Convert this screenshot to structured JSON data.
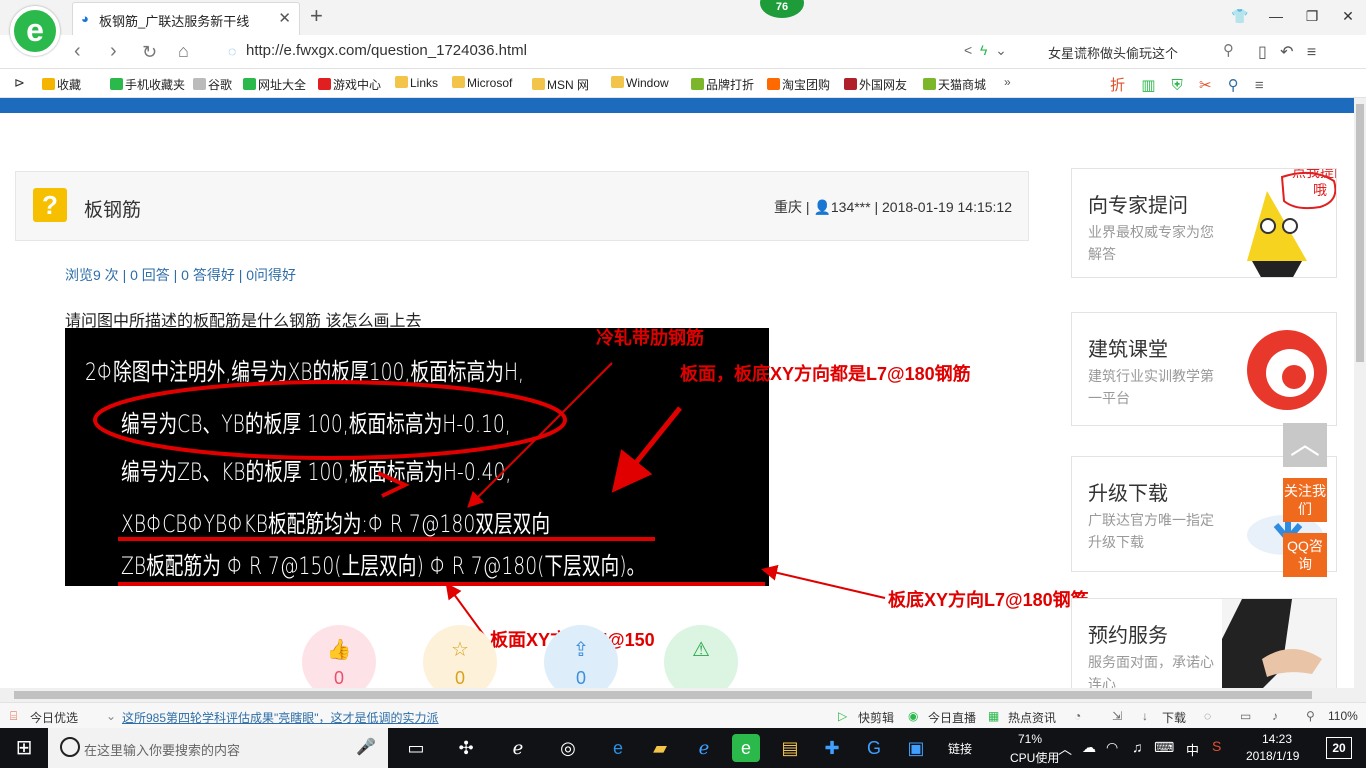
{
  "browser": {
    "logo_glyph": "e",
    "tab_title": "板钢筋_广联达服务新干线",
    "tab_icon": "page-icon",
    "notification_count": "76",
    "url": "http://e.fwxgx.com/question_1724036.html",
    "search_text": "女星谎称做头偷玩这个"
  },
  "bookmarks": [
    {
      "label": "收藏",
      "icon": "star-icon",
      "color": "#f5b400"
    },
    {
      "label": "手机收藏夹",
      "icon": "phone-icon",
      "color": "#2ab94a"
    },
    {
      "label": "谷歌",
      "icon": "page-icon",
      "color": "#bbbbbb"
    },
    {
      "label": "网址大全",
      "icon": "globe-icon",
      "color": "#2ab94a"
    },
    {
      "label": "游戏中心",
      "icon": "game-icon",
      "color": "#e02020"
    },
    {
      "label": "Links",
      "icon": "folder-icon",
      "color": "#f3c44a"
    },
    {
      "label": "Microsof",
      "icon": "folder-icon",
      "color": "#f3c44a"
    },
    {
      "label": "MSN 网",
      "icon": "folder-icon",
      "color": "#f3c44a"
    },
    {
      "label": "Window",
      "icon": "folder-icon",
      "color": "#f3c44a"
    },
    {
      "label": "品牌打折",
      "icon": "leaf-icon",
      "color": "#7bb62b"
    },
    {
      "label": "淘宝团购",
      "icon": "taobao-icon",
      "color": "#ff6a00"
    },
    {
      "label": "外国网友",
      "icon": "bookmark-icon",
      "color": "#b0202a"
    },
    {
      "label": "天猫商城",
      "icon": "leaf-icon",
      "color": "#7bb62b"
    }
  ],
  "page": {
    "question": {
      "title": "板钢筋",
      "location": "重庆",
      "user": "134***",
      "datetime": "2018-01-19 14:15:12",
      "stats": "浏览9 次 | 0 回答 | 0 答得好 | 0问得好",
      "body": "请问图中所描述的板配筋是什么钢筋  该怎么画上去"
    },
    "cad_lines": [
      "2Φ除图中注明外,编号为XB的板厚100,板面标高为H,",
      "编号为CB、YB的板厚 100,板面标高为H-0.10,",
      "编号为ZB、KB的板厚 100,板面标高为H-0.40,",
      "XBΦCBΦYBΦKB板配筋均为:Φ R  7@180双层双向",
      "ZB板配筋为 Φ R  7@150(上层双向)  Φ R  7@180(下层双向)。"
    ],
    "annotations": {
      "cold_rolled": "冷轧带肋钢筋",
      "top_bottom": "板面，板底XY方向都是L7@180钢筋",
      "bottom": "板底XY方向L7@180钢筋",
      "top": "板面XY方向L7@150"
    },
    "actions": [
      {
        "icon": "thumbs-up-icon",
        "count": "0",
        "color": "#e8506a",
        "bg": "#fde3e8"
      },
      {
        "icon": "star-icon",
        "count": "0",
        "color": "#d9a21e",
        "bg": "#fdf1d9"
      },
      {
        "icon": "share-icon",
        "count": "0",
        "color": "#3c8fd8",
        "bg": "#ddedfa"
      },
      {
        "icon": "warning-icon",
        "count": "",
        "color": "#2aa84a",
        "bg": "#dcf4e2"
      }
    ],
    "sidebar": {
      "ask": {
        "title": "向专家提问",
        "sub": "业界最权威专家为您解答",
        "bubble": "点我提问哦"
      },
      "course": {
        "title": "建筑课堂",
        "sub": "建筑行业实训教学第一平台"
      },
      "download": {
        "title": "升级下载",
        "sub": "广联达官方唯一指定升级下载"
      },
      "booking": {
        "title": "预约服务",
        "sub": "服务面对面，承诺心连心"
      },
      "follow": "关注我们",
      "qq": "QQ咨询"
    }
  },
  "statusbar": {
    "left": "今日优选",
    "news": "这所985第四轮学科评估成果\"亮瞎眼\"，这才是低调的实力派",
    "items": [
      "快剪辑",
      "今日直播",
      "热点资讯",
      "下载"
    ],
    "zoom": "110%"
  },
  "taskbar": {
    "search_placeholder": "在这里输入你要搜索的内容",
    "link_label": "链接",
    "cpu_percent": "71%",
    "cpu_label": "CPU使用",
    "ime": "中",
    "time": "14:23",
    "date": "2018/1/19",
    "notify_count": "20"
  }
}
